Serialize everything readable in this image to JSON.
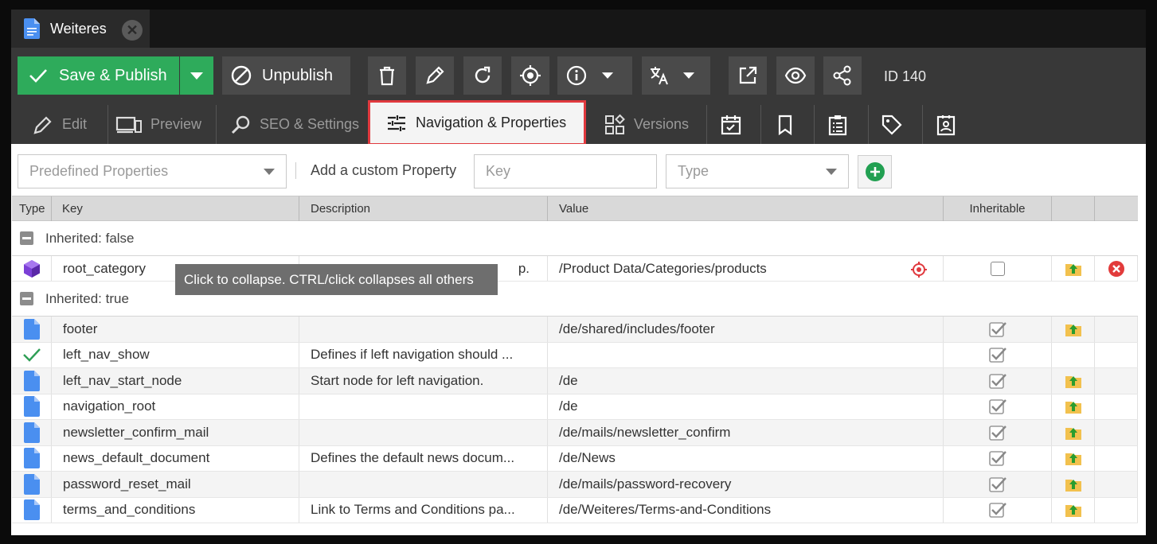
{
  "tab": {
    "title": "Weiteres"
  },
  "toolbar": {
    "save_label": "Save & Publish",
    "unpublish_label": "Unpublish",
    "id_text": "ID 140"
  },
  "subtabs": {
    "edit": "Edit",
    "preview": "Preview",
    "seo": "SEO & Settings",
    "navigation": "Navigation & Properties",
    "versions": "Versions"
  },
  "filters": {
    "predefined_placeholder": "Predefined Properties",
    "custom_label": "Add a custom Property",
    "key_placeholder": "Key",
    "type_placeholder": "Type"
  },
  "columns": {
    "type": "Type",
    "key": "Key",
    "description": "Description",
    "value": "Value",
    "inheritable": "Inheritable"
  },
  "groups": {
    "false_label": "Inherited: false",
    "true_label": "Inherited: true"
  },
  "tooltip": "Click to collapse. CTRL/click collapses all others",
  "root_row": {
    "key": "root_category",
    "description": "p.",
    "value": "/Product Data/Categories/products"
  },
  "rows": [
    {
      "type": "document",
      "key": "footer",
      "description": "",
      "value": "/de/shared/includes/footer"
    },
    {
      "type": "bool",
      "key": "left_nav_show",
      "description": "Defines if left navigation should ...",
      "value": ""
    },
    {
      "type": "document",
      "key": "left_nav_start_node",
      "description": "Start node for left navigation.",
      "value": "/de"
    },
    {
      "type": "document",
      "key": "navigation_root",
      "description": "",
      "value": "/de"
    },
    {
      "type": "document",
      "key": "newsletter_confirm_mail",
      "description": "",
      "value": "/de/mails/newsletter_confirm"
    },
    {
      "type": "document",
      "key": "news_default_document",
      "description": "Defines the default news docum...",
      "value": "/de/News"
    },
    {
      "type": "document",
      "key": "password_reset_mail",
      "description": "",
      "value": "/de/mails/password-recovery"
    },
    {
      "type": "document",
      "key": "terms_and_conditions",
      "description": "Link to Terms and Conditions pa...",
      "value": "/de/Weiteres/Terms-and-Conditions"
    }
  ]
}
